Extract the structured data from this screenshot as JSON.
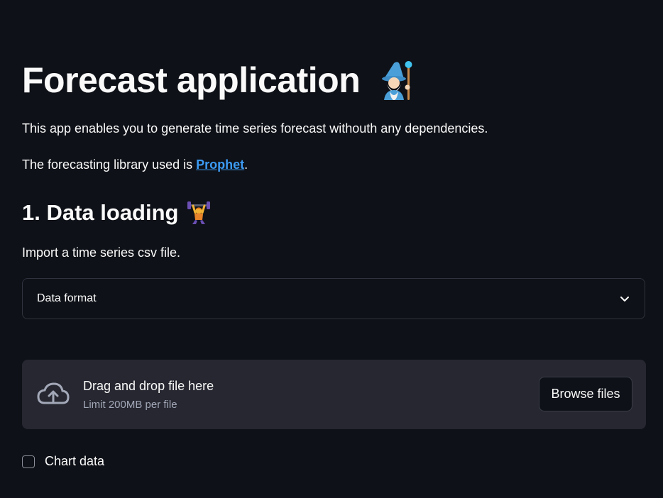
{
  "title": "Forecast application",
  "title_emoji": "mage-emoji",
  "intro": "This app enables you to generate time series forecast withouth any dependencies.",
  "library_prefix": "The forecasting library used is ",
  "library_link": "Prophet",
  "library_suffix": ".",
  "section1": {
    "heading": "1. Data loading",
    "heading_emoji": "weightlifter-emoji",
    "description": "Import a time series csv file."
  },
  "expander": {
    "label": "Data format",
    "icon": "chevron-down-icon"
  },
  "uploader": {
    "icon": "cloud-upload-icon",
    "main_text": "Drag and drop file here",
    "limit_text": "Limit 200MB per file",
    "browse_label": "Browse files"
  },
  "checkbox": {
    "label": "Chart data",
    "checked": false
  },
  "colors": {
    "background": "#0e1117",
    "text": "#fafafa",
    "link": "#3c9bf4",
    "dropzone": "#262730",
    "muted": "#a3a8b8"
  }
}
